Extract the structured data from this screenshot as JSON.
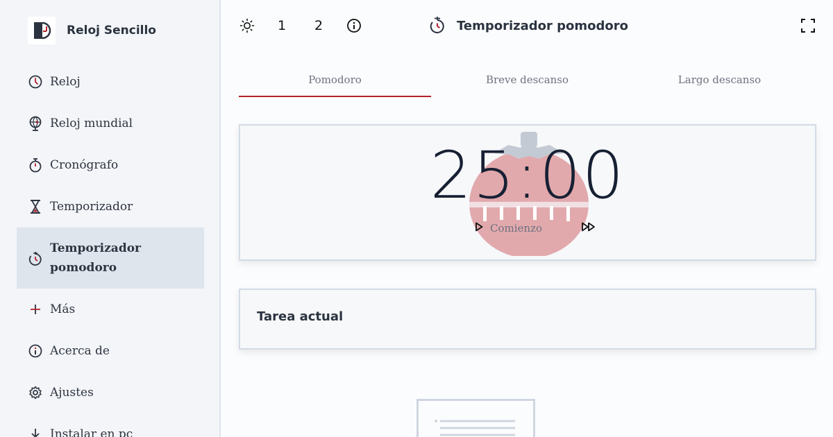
{
  "app": {
    "name": "Reloj Sencillo",
    "logo_icon": "app-logo-icon"
  },
  "sidebar": {
    "items": [
      {
        "label": "Reloj",
        "icon": "clock-icon"
      },
      {
        "label": "Reloj mundial",
        "icon": "globe-icon"
      },
      {
        "label": "Cronógrafo",
        "icon": "stopwatch-icon"
      },
      {
        "label": "Temporizador",
        "icon": "hourglass-icon"
      },
      {
        "label": "Temporizador pomodoro",
        "icon": "pomodoro-icon",
        "active": true
      },
      {
        "label": "Más",
        "icon": "plus-icon"
      },
      {
        "label": "Acerca de",
        "icon": "info-icon"
      },
      {
        "label": "Ajustes",
        "icon": "gear-icon"
      },
      {
        "label": "Instalar en pc",
        "icon": "download-icon"
      }
    ]
  },
  "topbar": {
    "theme_icon": "sun-icon",
    "size_1": "1",
    "size_2": "2",
    "info_icon": "info-icon",
    "title": "Temporizador pomodoro",
    "fullscreen_icon": "fullscreen-icon"
  },
  "tabs": [
    {
      "label": "Pomodoro",
      "active": true
    },
    {
      "label": "Breve descanso"
    },
    {
      "label": "Largo descanso"
    }
  ],
  "timer": {
    "time": "25:00",
    "start_label": "Comienzo",
    "start_icon": "play-icon",
    "skip_icon": "fast-forward-icon"
  },
  "task": {
    "title": "Tarea actual"
  },
  "colors": {
    "accent": "#b5212b",
    "sidebar_bg": "#f3f5f8",
    "active_bg": "#dfe5ed",
    "tomato": "#e2a9ad"
  }
}
